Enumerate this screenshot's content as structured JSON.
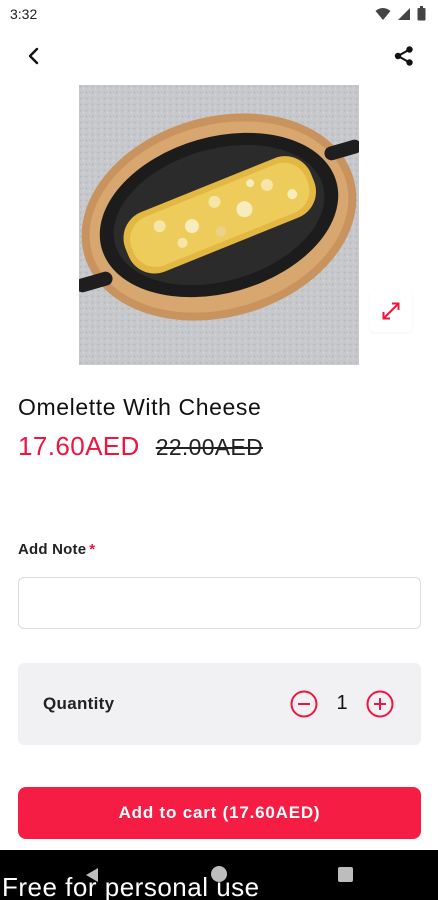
{
  "status_bar": {
    "time": "3:32",
    "icons": [
      "wifi-icon",
      "signal-icon",
      "battery-icon"
    ]
  },
  "app_bar": {
    "back_icon": "chevron-left-icon",
    "share_icon": "share-icon"
  },
  "product": {
    "image_icon": "omelette-photo",
    "expand_icon": "expand-arrows-icon",
    "title": "Omelette With Cheese",
    "price_current": "17.60AED",
    "price_original": "22.00AED"
  },
  "note": {
    "label": "Add Note",
    "required_mark": "*",
    "value": "",
    "placeholder": ""
  },
  "quantity": {
    "label": "Quantity",
    "value": "1",
    "minus_icon": "minus-circle-icon",
    "plus_icon": "plus-circle-icon"
  },
  "cart": {
    "button_label": "Add to cart (17.60AED)"
  },
  "system_nav": {
    "icons": [
      "back-triangle-icon",
      "home-circle-icon",
      "recents-square-icon"
    ]
  },
  "watermark": {
    "text": "Free for personal use"
  },
  "colors": {
    "accent": "#f0153f",
    "button": "#f51d44",
    "qty_bg": "#f1f1f3"
  }
}
